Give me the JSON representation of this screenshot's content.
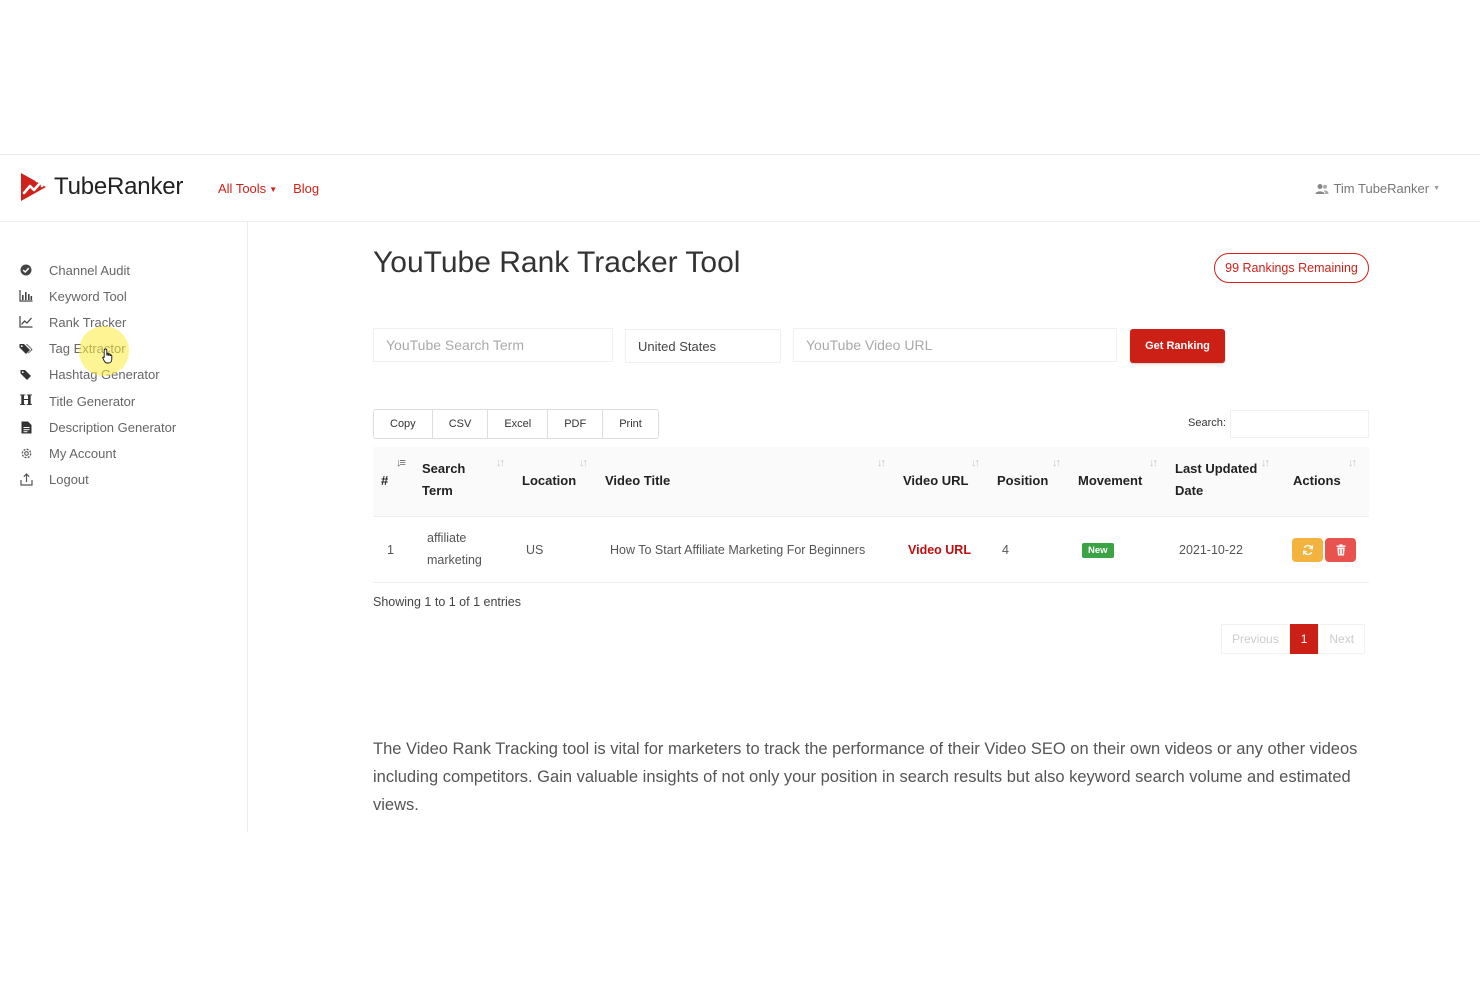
{
  "header": {
    "logo_text": "TubeRanker",
    "nav": [
      {
        "label": "All Tools",
        "has_caret": true
      },
      {
        "label": "Blog",
        "has_caret": false
      }
    ],
    "user_name": "Tim TubeRanker"
  },
  "sidebar": {
    "items": [
      {
        "label": "Channel Audit",
        "icon": "check-circle-icon"
      },
      {
        "label": "Keyword Tool",
        "icon": "bar-chart-icon"
      },
      {
        "label": "Rank Tracker",
        "icon": "line-chart-icon"
      },
      {
        "label": "Tag Extractor",
        "icon": "tags-icon"
      },
      {
        "label": "Hashtag Generator",
        "icon": "tag-icon"
      },
      {
        "label": "Title Generator",
        "icon": "heading-icon"
      },
      {
        "label": "Description Generator",
        "icon": "document-icon"
      },
      {
        "label": "My Account",
        "icon": "gear-icon"
      },
      {
        "label": "Logout",
        "icon": "logout-icon"
      }
    ]
  },
  "main": {
    "title": "YouTube Rank Tracker Tool",
    "rankings_remaining": "99 Rankings Remaining",
    "form": {
      "search_term_placeholder": "YouTube Search Term",
      "country_value": "United States",
      "video_url_placeholder": "YouTube Video URL",
      "submit_label": "Get Ranking"
    },
    "export_buttons": [
      "Copy",
      "CSV",
      "Excel",
      "PDF",
      "Print"
    ],
    "search_label": "Search:",
    "table": {
      "headers": {
        "num": "#",
        "search_term_1": "Search",
        "search_term_2": "Term",
        "location": "Location",
        "video_title": "Video Title",
        "video_url": "Video URL",
        "position": "Position",
        "movement": "Movement",
        "last_updated_1": "Last Updated",
        "last_updated_2": "Date",
        "actions": "Actions"
      },
      "rows": [
        {
          "num": "1",
          "search_term_1": "affiliate",
          "search_term_2": "marketing",
          "location": "US",
          "video_title": "How To Start Affiliate Marketing For Beginners",
          "video_url": "Video URL",
          "position": "4",
          "movement": "New",
          "last_updated": "2021-10-22"
        }
      ]
    },
    "showing_text": "Showing 1 to 1 of 1 entries",
    "pagination": {
      "previous": "Previous",
      "current": "1",
      "next": "Next"
    },
    "description": "The Video Rank Tracking tool is vital for marketers to track the performance of their Video SEO on their own videos or any other videos including competitors. Gain valuable insights of not only your position in search results but also keyword search volume and estimated views."
  },
  "colors": {
    "brand_red": "#cc1f16",
    "badge_green": "#3aa345",
    "refresh_orange": "#f4b23e",
    "delete_red": "#e9534f"
  }
}
